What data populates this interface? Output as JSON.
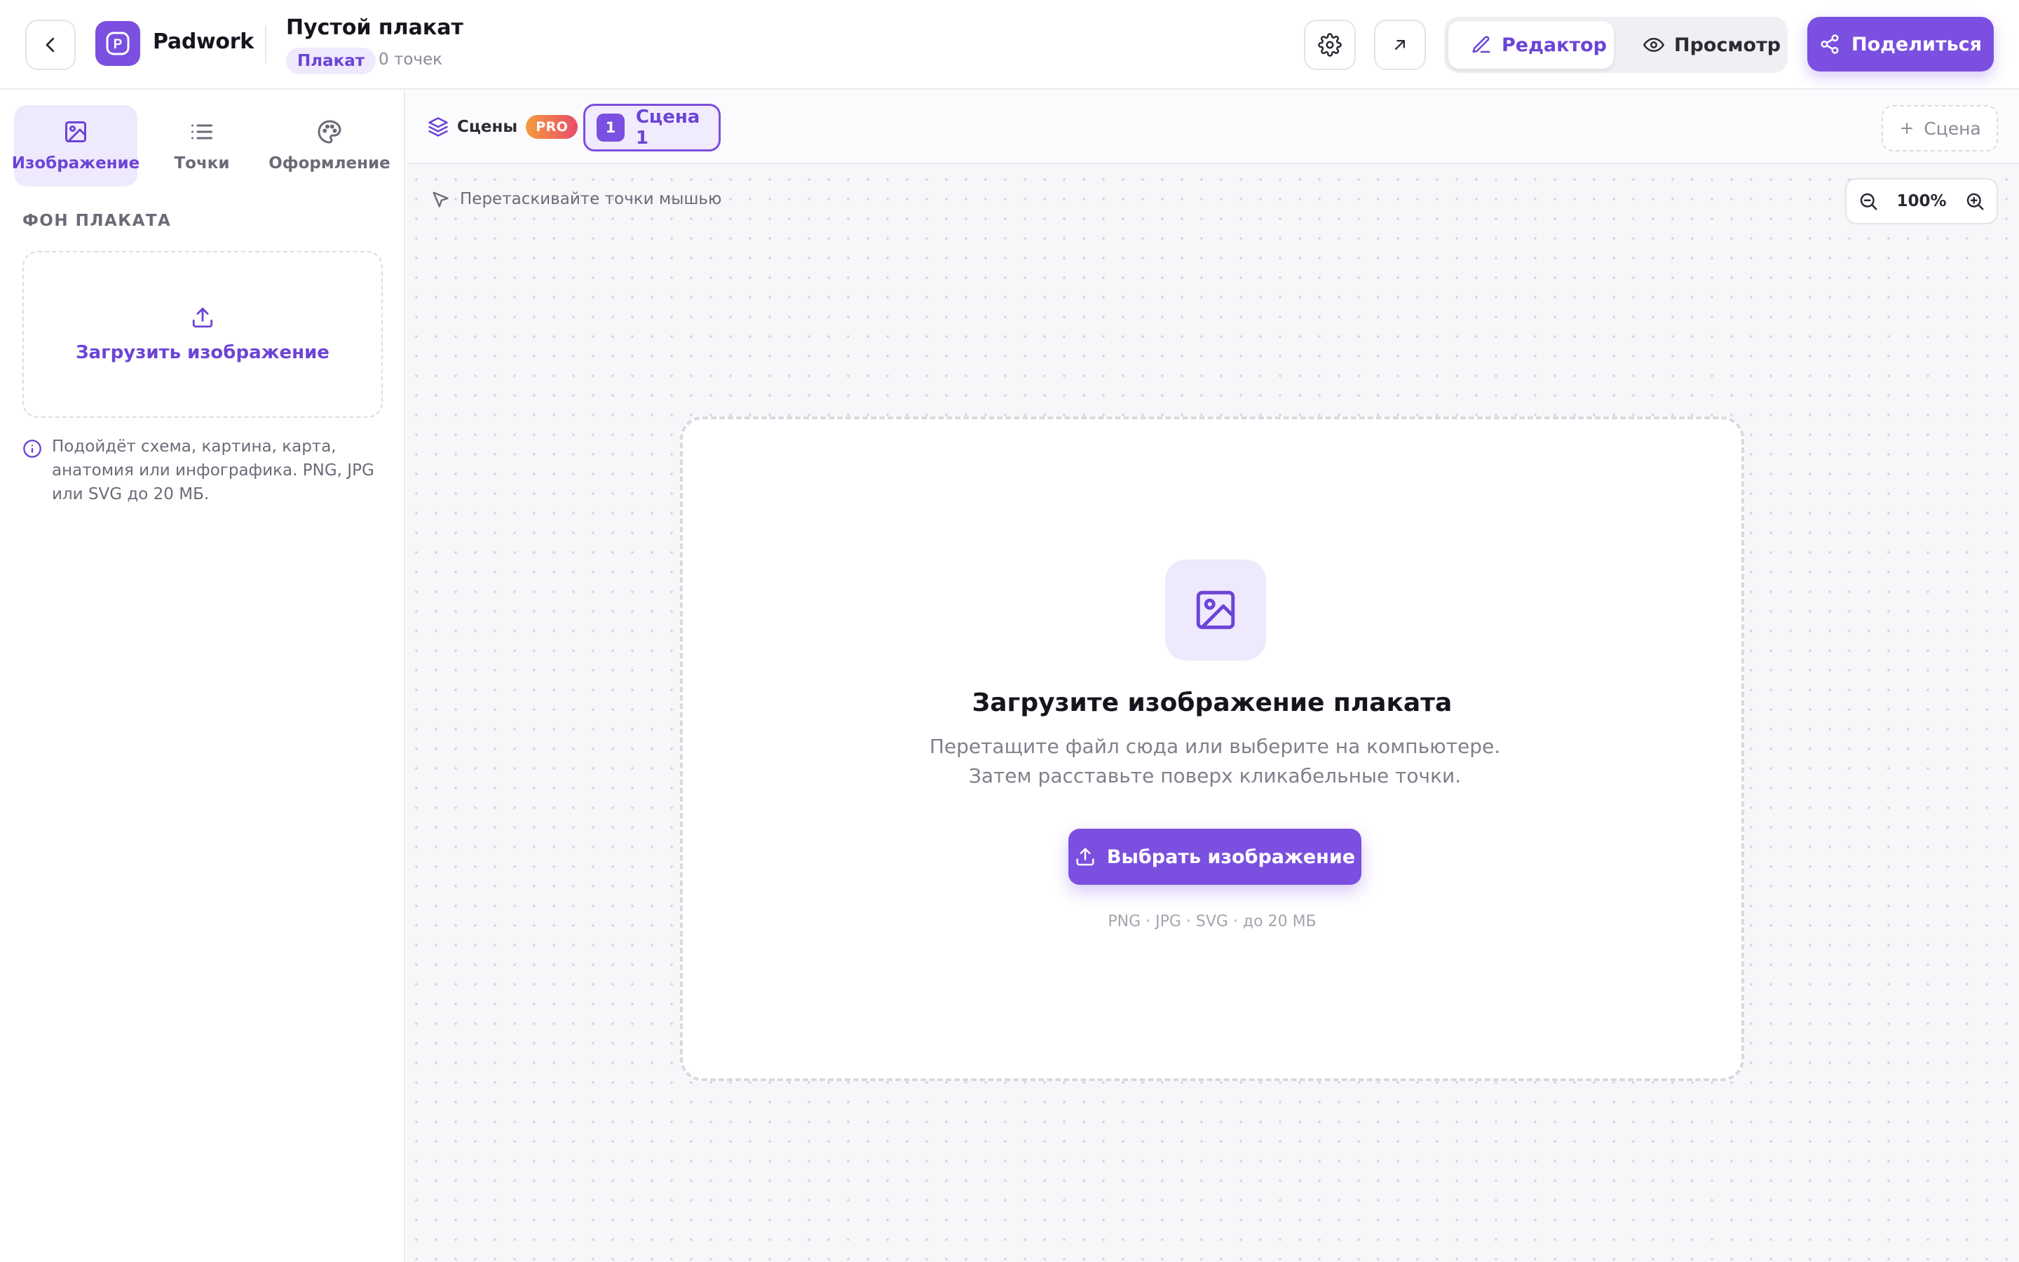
{
  "header": {
    "brand": "Padwork",
    "logo_letter": "P",
    "doc_title": "Пустой плакат",
    "doc_badge": "Плакат",
    "points_count": "0 точек",
    "mode_editor": "Редактор",
    "mode_preview": "Просмотр",
    "share_label": "Поделиться"
  },
  "sidebar": {
    "tabs": [
      {
        "label": "Изображение",
        "icon": "image-icon",
        "active": true
      },
      {
        "label": "Точки",
        "icon": "list-icon",
        "active": false
      },
      {
        "label": "Оформление",
        "icon": "palette-icon",
        "active": false
      }
    ],
    "section_label": "ФОН ПЛАКАТА",
    "upload_label": "Загрузить изображение",
    "hint": "Подойдёт схема, картина, карта, анатомия или инфографика. PNG, JPG или SVG до 20 МБ."
  },
  "scene_bar": {
    "scenes_label": "Сцены",
    "pro_badge": "PRO",
    "active_scene_number": "1",
    "active_scene_label": "Сцена 1",
    "add_scene_label": "Сцена"
  },
  "canvas": {
    "drag_hint": "Перетаскивайте точки мышью",
    "zoom_value": "100%",
    "drop_title": "Загрузите изображение плаката",
    "drop_description": "Перетащите файл сюда или выберите на компьютере. Затем расставьте поверх кликабельные точки.",
    "choose_button": "Выбрать изображение",
    "formats": "PNG · JPG · SVG · до 20 МБ"
  },
  "colors": {
    "accent": "#7b4fe0",
    "accent_text": "#6c44d6",
    "accent_soft": "#efe9fd",
    "pro_gradient_start": "#f59a3c",
    "pro_gradient_end": "#e84c6b"
  }
}
